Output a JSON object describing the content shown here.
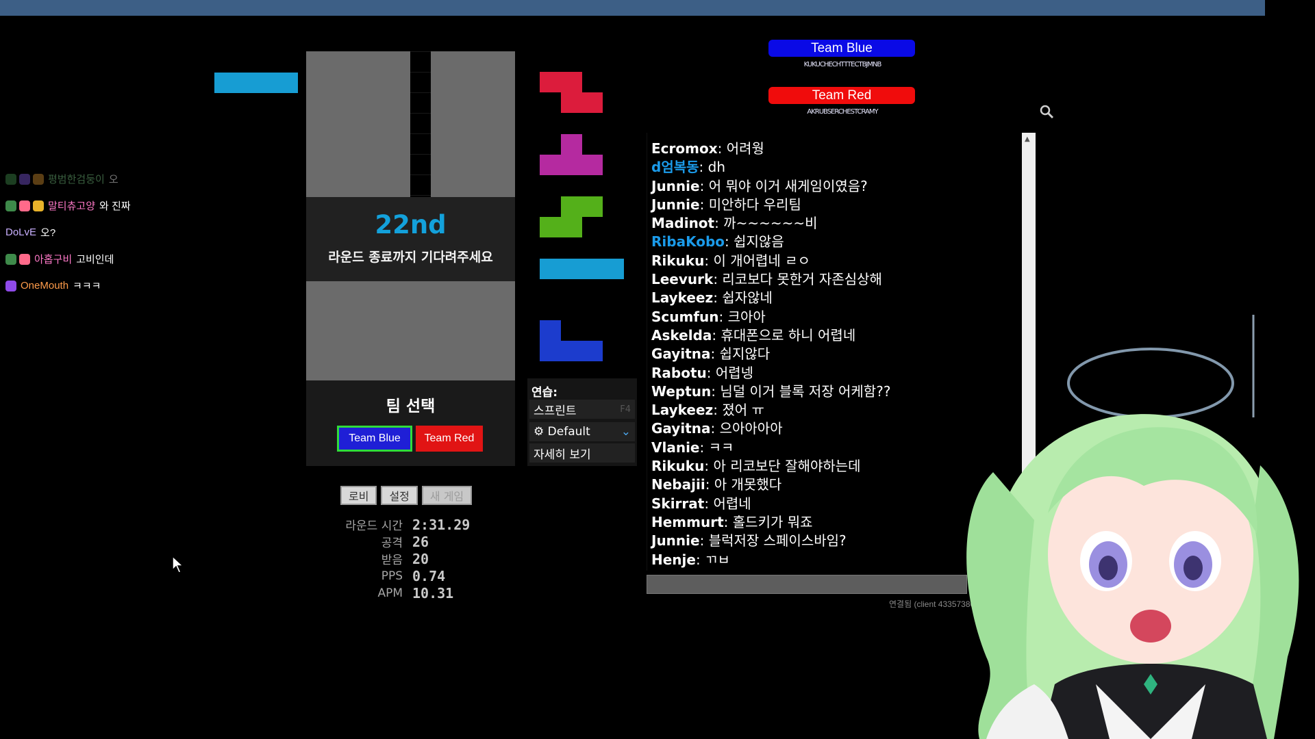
{
  "colors": {
    "team_blue": "#1f1fd6",
    "team_red": "#e11414",
    "accent_place": "#13a1db",
    "topbar": "#3d5f86"
  },
  "overlay_chat": [
    {
      "name": "평범한검둥이",
      "message": "오",
      "name_color": "#7fd08a",
      "badges": [
        "#3e8a4a",
        "#7a55d6",
        "#c98a2e"
      ],
      "faded": true
    },
    {
      "name": "말티츄고양",
      "message": "와 진짜",
      "name_color": "#ff79c8",
      "badges": [
        "#3e8a4a",
        "#ff6a8a",
        "#e9b22a"
      ],
      "faded": false
    },
    {
      "name": "DoLvE",
      "message": "오?",
      "name_color": "#c9b0ff",
      "badges": [],
      "faded": false
    },
    {
      "name": "아홉구비",
      "message": "고비인데",
      "name_color": "#ff79c8",
      "badges": [
        "#3e8a4a",
        "#ff6a8a"
      ],
      "faded": false
    },
    {
      "name": "OneMouth",
      "message": "ㅋㅋㅋ",
      "name_color": "#ff9c4a",
      "badges": [
        "#8f4ae9"
      ],
      "faded": false
    }
  ],
  "board": {
    "place": "22nd",
    "wait_message": "라운드 종료까지 기다려주세요"
  },
  "team_select": {
    "title": "팀 선택",
    "blue_label": "Team Blue",
    "red_label": "Team Red"
  },
  "menu": {
    "lobby": "로비",
    "settings": "설정",
    "new_game": "새 게임"
  },
  "stats": [
    {
      "label": "라운드 시간",
      "value": "2:31.29"
    },
    {
      "label": "공격",
      "value": "26"
    },
    {
      "label": "받음",
      "value": "20"
    },
    {
      "label": "PPS",
      "value": "0.74"
    },
    {
      "label": "APM",
      "value": "10.31"
    }
  ],
  "next_queue": [
    {
      "piece": "Z",
      "color": "#dc1c3c"
    },
    {
      "piece": "T",
      "color": "#b52aa0"
    },
    {
      "piece": "S",
      "color": "#54b01a"
    },
    {
      "piece": "I",
      "color": "#179dd3"
    },
    {
      "piece": "J",
      "color": "#1c3ccd"
    }
  ],
  "practice": {
    "title": "연습:",
    "sprint": "스프린트",
    "sprint_hotkey": "F4",
    "preset": "Default",
    "details": "자세히 보기"
  },
  "team_info": {
    "blue_label": "Team Blue",
    "blue_members": "KUKUCHECHTTTECTBJMNB",
    "red_label": "Team Red",
    "red_members": "AKRUBSERCHESTCRAMY"
  },
  "chat": [
    {
      "name": "Ecromox",
      "message": "어려웡",
      "blue": false
    },
    {
      "name": "d엄복동",
      "message": "dh",
      "blue": true
    },
    {
      "name": "Junnie",
      "message": "어 뭐야 이거 새게임이였음?",
      "blue": false
    },
    {
      "name": "Junnie",
      "message": "미안하다 우리팀",
      "blue": false
    },
    {
      "name": "Madinot",
      "message": "까~~~~~~비",
      "blue": false
    },
    {
      "name": "RibaKobo",
      "message": "쉽지않음",
      "blue": true
    },
    {
      "name": "Rikuku",
      "message": "이 개어렵네 ㄹㅇ",
      "blue": false
    },
    {
      "name": "Leevurk",
      "message": "리코보다 못한거 자존심상해",
      "blue": false
    },
    {
      "name": "Laykeez",
      "message": "쉽자않네",
      "blue": false
    },
    {
      "name": "Scumfun",
      "message": "크아아",
      "blue": false
    },
    {
      "name": "Askelda",
      "message": "휴대폰으로 하니 어렵네",
      "blue": false
    },
    {
      "name": "Gayitna",
      "message": "쉽지않다",
      "blue": false
    },
    {
      "name": "Rabotu",
      "message": "어렵넹",
      "blue": false
    },
    {
      "name": "Weptun",
      "message": "님덜 이거 블록 저장 어케함??",
      "blue": false
    },
    {
      "name": "Laykeez",
      "message": "졌어 ㅠ",
      "blue": false
    },
    {
      "name": "Gayitna",
      "message": "으아아아아",
      "blue": false
    },
    {
      "name": "Vlanie",
      "message": "ㅋㅋ",
      "blue": false
    },
    {
      "name": "Rikuku",
      "message": "아 리코보단 잘해야하는데",
      "blue": false
    },
    {
      "name": "Nebajii",
      "message": "아 개못했다",
      "blue": false
    },
    {
      "name": "Skirrat",
      "message": "어렵네",
      "blue": false
    },
    {
      "name": "Hemmurt",
      "message": "홀드키가 뭐죠",
      "blue": false
    },
    {
      "name": "Junnie",
      "message": "블럭저장 스페이스바임?",
      "blue": false
    },
    {
      "name": "Henje",
      "message": "ㄲㅂ",
      "blue": false
    }
  ],
  "connection": "연결됨 (client 43357386), s:2, c"
}
